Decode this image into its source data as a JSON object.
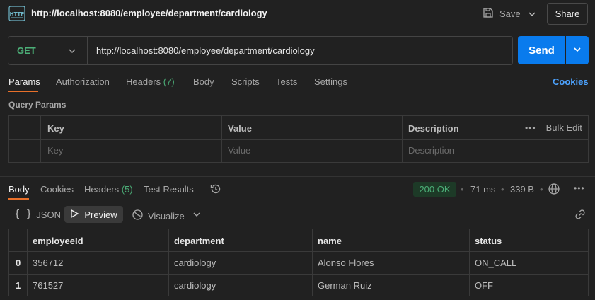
{
  "header": {
    "title": "http://localhost:8080/employee/department/cardiology",
    "icon": "http-icon",
    "save_label": "Save",
    "share_label": "Share"
  },
  "request": {
    "method": "GET",
    "url": "http://localhost:8080/employee/department/cardiology",
    "send_label": "Send"
  },
  "request_tabs": {
    "params": "Params",
    "authorization": "Authorization",
    "headers": "Headers",
    "headers_count": "(7)",
    "body": "Body",
    "scripts": "Scripts",
    "tests": "Tests",
    "settings": "Settings",
    "cookies": "Cookies"
  },
  "query_params": {
    "label": "Query Params",
    "columns": [
      "Key",
      "Value",
      "Description"
    ],
    "bulk_edit": "Bulk Edit",
    "placeholders": [
      "Key",
      "Value",
      "Description"
    ]
  },
  "response_tabs": {
    "body": "Body",
    "cookies": "Cookies",
    "headers": "Headers",
    "headers_count": "(5)",
    "test_results": "Test Results"
  },
  "response_meta": {
    "status": "200 OK",
    "time": "71 ms",
    "size": "339 B"
  },
  "view_modes": {
    "json": "JSON",
    "preview": "Preview",
    "visualize": "Visualize"
  },
  "response_table": {
    "columns": [
      "employeeId",
      "department",
      "name",
      "status"
    ],
    "rows": [
      {
        "index": "0",
        "employeeId": "356712",
        "department": "cardiology",
        "name": "Alonso Flores",
        "status": "ON_CALL"
      },
      {
        "index": "1",
        "employeeId": "761527",
        "department": "cardiology",
        "name": "German Ruiz",
        "status": "OFF"
      }
    ]
  },
  "colors": {
    "accent": "#e8702a",
    "send": "#097bed",
    "method_get": "#4caf78",
    "status_ok": "#4caf78",
    "link": "#4da3ff"
  }
}
